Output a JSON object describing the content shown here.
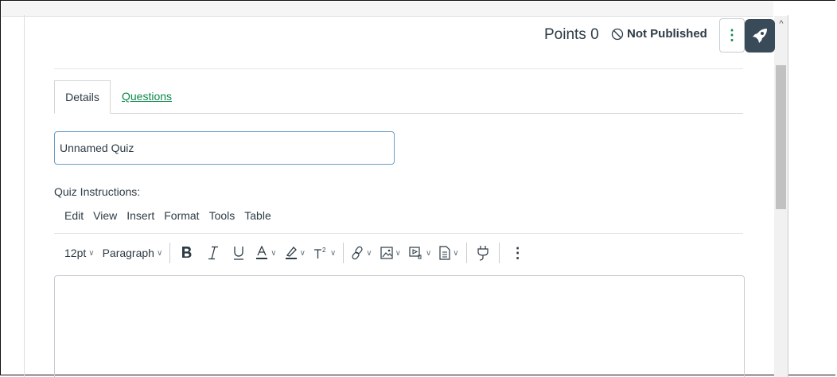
{
  "header": {
    "points_label": "Points",
    "points_value": "0",
    "publish_status": "Not Published",
    "more_icon": "kebab-vertical-icon",
    "launcher_icon": "rocket-icon"
  },
  "tabs": [
    {
      "label": "Details",
      "active": true
    },
    {
      "label": "Questions",
      "active": false
    }
  ],
  "quiz": {
    "title_value": "Unnamed Quiz",
    "instructions_label": "Quiz Instructions:"
  },
  "editor": {
    "menu": [
      "Edit",
      "View",
      "Insert",
      "Format",
      "Tools",
      "Table"
    ],
    "font_size": "12pt",
    "block_format": "Paragraph",
    "toolbar_icons": [
      "bold-icon",
      "italic-icon",
      "underline-icon",
      "text-color-icon",
      "highlight-icon",
      "superscript-icon",
      "link-icon",
      "image-icon",
      "media-icon",
      "document-icon",
      "plugin-icon",
      "more-icon"
    ]
  },
  "colors": {
    "accent": "#0b874b",
    "text": "#2d3b45",
    "focus_border": "#6aa0c8",
    "launcher_bg": "#394b58"
  }
}
